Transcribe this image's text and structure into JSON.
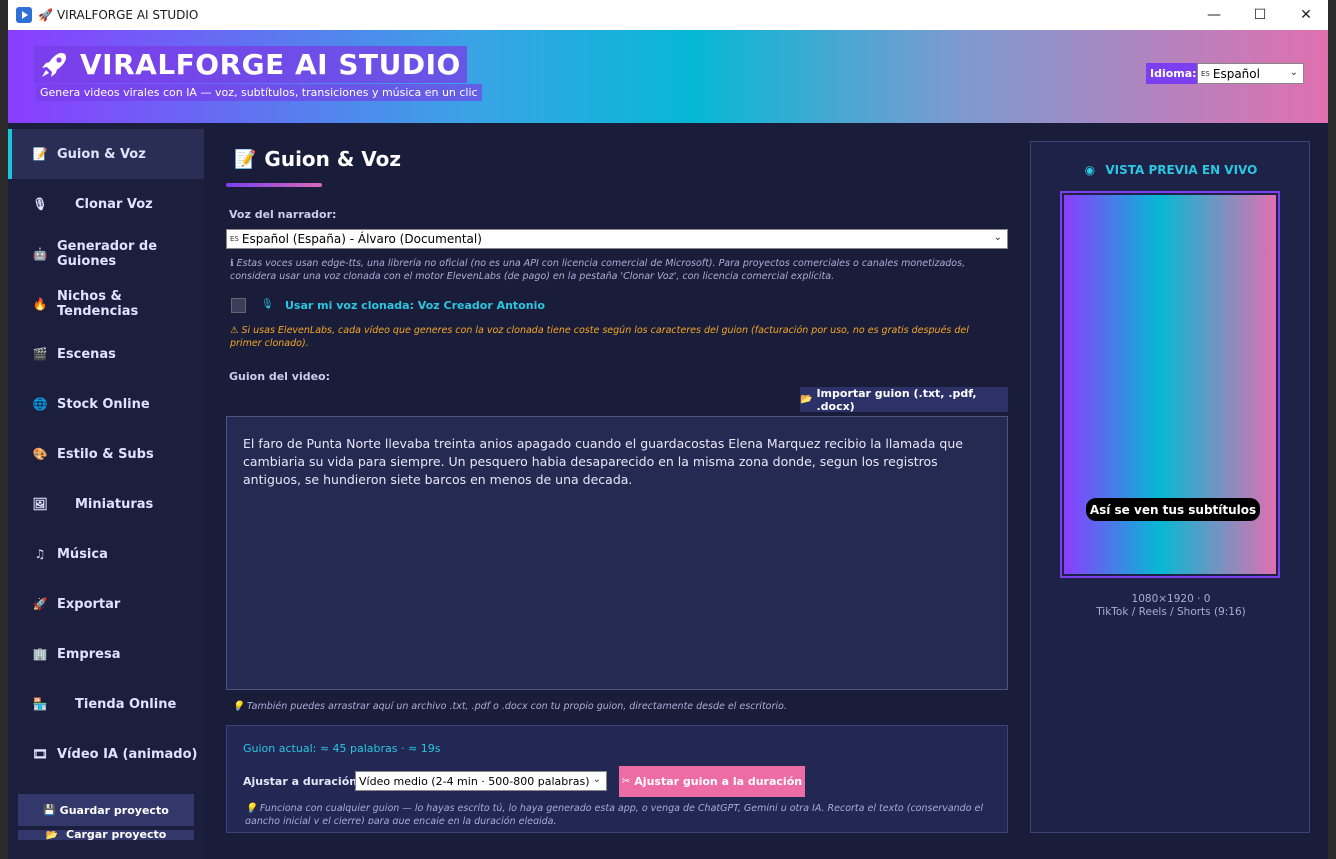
{
  "window": {
    "title": "VIRALFORGE AI STUDIO",
    "min_glyph": "—",
    "max_glyph": "☐",
    "close_glyph": "✕"
  },
  "header": {
    "brand_title": "VIRALFORGE AI STUDIO",
    "brand_subtitle": "Genera videos virales con IA — voz, subtítulos, transiciones y música en un clic",
    "lang_label": "Idioma:",
    "lang_flag": "ES",
    "lang_value": "Español"
  },
  "sidebar": {
    "items": [
      {
        "label": "Guion & Voz",
        "icon": "script-icon",
        "active": true
      },
      {
        "label": "Clonar Voz",
        "icon": "microphone-icon"
      },
      {
        "label": "Generador de Guiones",
        "icon": "robot-icon"
      },
      {
        "label": "Nichos & Tendencias",
        "icon": "fire-icon"
      },
      {
        "label": "Escenas",
        "icon": "clapper-icon"
      },
      {
        "label": "Stock Online",
        "icon": "globe-icon"
      },
      {
        "label": "Estilo & Subs",
        "icon": "palette-icon"
      },
      {
        "label": "Miniaturas",
        "icon": "image-icon"
      },
      {
        "label": "Música",
        "icon": "music-icon"
      },
      {
        "label": "Exportar",
        "icon": "rocket-icon"
      },
      {
        "label": "Empresa",
        "icon": "building-icon"
      },
      {
        "label": "Tienda Online",
        "icon": "store-icon"
      },
      {
        "label": "Vídeo IA (animado)",
        "icon": "video-icon"
      }
    ],
    "save_label": "Guardar proyecto",
    "load_label": "Cargar proyecto"
  },
  "main": {
    "title": "Guion & Voz",
    "voice_label": "Voz del narrador:",
    "voice_flag": "ES",
    "voice_value": "Español (España) - Álvaro (Documental)",
    "voice_note": "ℹ Estas voces usan edge-tts, una librería no oficial (no es una API con licencia comercial de Microsoft). Para proyectos comerciales o canales monetizados, considera usar una voz clonada con el motor ElevenLabs (de pago) en la pestaña 'Clonar Voz', con licencia comercial explícita.",
    "clone_label": "Usar mi voz clonada: Voz Creador Antonio",
    "clone_warning": "⚠ Si usas ElevenLabs, cada vídeo que generes con la voz clonada tiene coste según los caracteres del guion (facturación por uso, no es gratis después del primer clonado).",
    "script_label": "Guion del video:",
    "import_label": "Importar guion (.txt, .pdf, .docx)",
    "script_text": "El faro de Punta Norte llevaba treinta anios apagado cuando el guardacostas Elena Marquez recibio la llamada que cambiaria su vida para siempre. Un pesquero habia desaparecido en la misma zona donde, segun los registros antiguos, se hundieron siete barcos en menos de una decada.",
    "drag_note": "💡 También puedes arrastrar aquí un archivo .txt, .pdf o .docx con tu propio guion, directamente desde el escritorio.",
    "current_count": "Guion actual: ≈ 45 palabras · ≈ 19s",
    "adjust_label": "Ajustar a duración:",
    "duration_value": "Vídeo medio (2-4 min · 500-800 palabras)",
    "adjust_button": "Ajustar guion a la duración",
    "func_note": "💡 Funciona con cualquier guion — lo hayas escrito tú, lo haya generado esta app, o venga de ChatGPT, Gemini u otra IA. Recorta el texto (conservando el gancho inicial y el cierre) para que encaje en la duración elegida."
  },
  "preview": {
    "title": "VISTA PREVIA EN VIVO",
    "subtitle_sample": "Así se ven tus subtítulos",
    "resolution": "1080×1920  ·  0",
    "platforms": "TikTok / Reels / Shorts (9:16)"
  },
  "colors": {
    "accent_cyan": "#19c5dd",
    "accent_purple": "#7b3ff0",
    "accent_pink": "#ee6ca5",
    "warning": "#f5a623",
    "bg": "#1a1d3a"
  }
}
